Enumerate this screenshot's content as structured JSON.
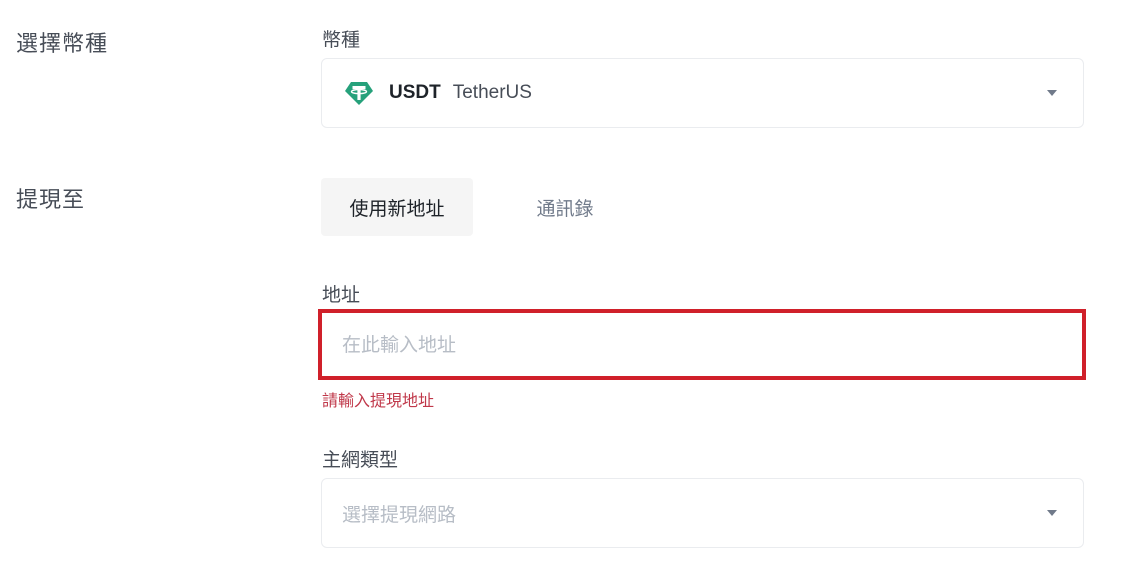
{
  "sections": {
    "select_coin_label": "選擇幣種",
    "withdraw_to_label": "提現至"
  },
  "coin": {
    "field_label": "幣種",
    "symbol": "USDT",
    "name": "TetherUS",
    "icon": "tether-icon",
    "icon_color": "#26a17b"
  },
  "tabs": [
    {
      "label": "使用新地址",
      "active": true
    },
    {
      "label": "通訊錄",
      "active": false
    }
  ],
  "address": {
    "field_label": "地址",
    "placeholder": "在此輸入地址",
    "value": "",
    "error": "請輸入提現地址",
    "error_color": "#c0384a",
    "highlight_color": "#d0202a"
  },
  "network": {
    "field_label": "主網類型",
    "placeholder": "選擇提現網路"
  }
}
